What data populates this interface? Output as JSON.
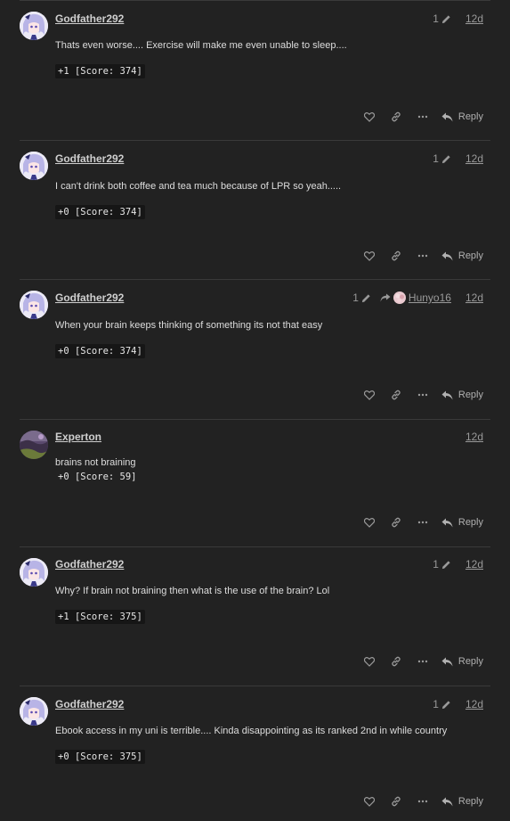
{
  "colors": {
    "background": "#222222",
    "text": "#dddddd",
    "muted": "#9a9a9a",
    "divider": "#3a3a3a",
    "code_bg": "#161616"
  },
  "posts": [
    {
      "username": "Godfather292",
      "edits": "1",
      "date": "12d",
      "body": "Thats even worse.... Exercise will make me even unable to sleep....",
      "code": "+1 [Score: 374]",
      "reply_label": "Reply",
      "avatar": "anime-avatar"
    },
    {
      "username": "Godfather292",
      "edits": "1",
      "date": "12d",
      "body": "I can't drink both coffee and tea much because of LPR so yeah.....",
      "code": "+0 [Score: 374]",
      "reply_label": "Reply",
      "avatar": "anime-avatar"
    },
    {
      "username": "Godfather292",
      "edits": "1",
      "reply_to": "Hunyo16",
      "date": "12d",
      "body": "When your brain keeps thinking of something its not that easy",
      "code": "+0 [Score: 374]",
      "reply_label": "Reply",
      "avatar": "anime-avatar"
    },
    {
      "username": "Experton",
      "date": "12d",
      "body": "brains not braining",
      "code": "+0 [Score: 59]",
      "reply_label": "Reply",
      "avatar": "landscape-avatar"
    },
    {
      "username": "Godfather292",
      "edits": "1",
      "date": "12d",
      "body": "Why? If brain not braining then what is the use of the brain? Lol",
      "code": "+1 [Score: 375]",
      "reply_label": "Reply",
      "avatar": "anime-avatar"
    },
    {
      "username": "Godfather292",
      "edits": "1",
      "date": "12d",
      "body": "Ebook access in my uni is terrible.... Kinda disappointing as its ranked 2nd in while country",
      "code": "+0 [Score: 375]",
      "reply_label": "Reply",
      "avatar": "anime-avatar"
    }
  ]
}
